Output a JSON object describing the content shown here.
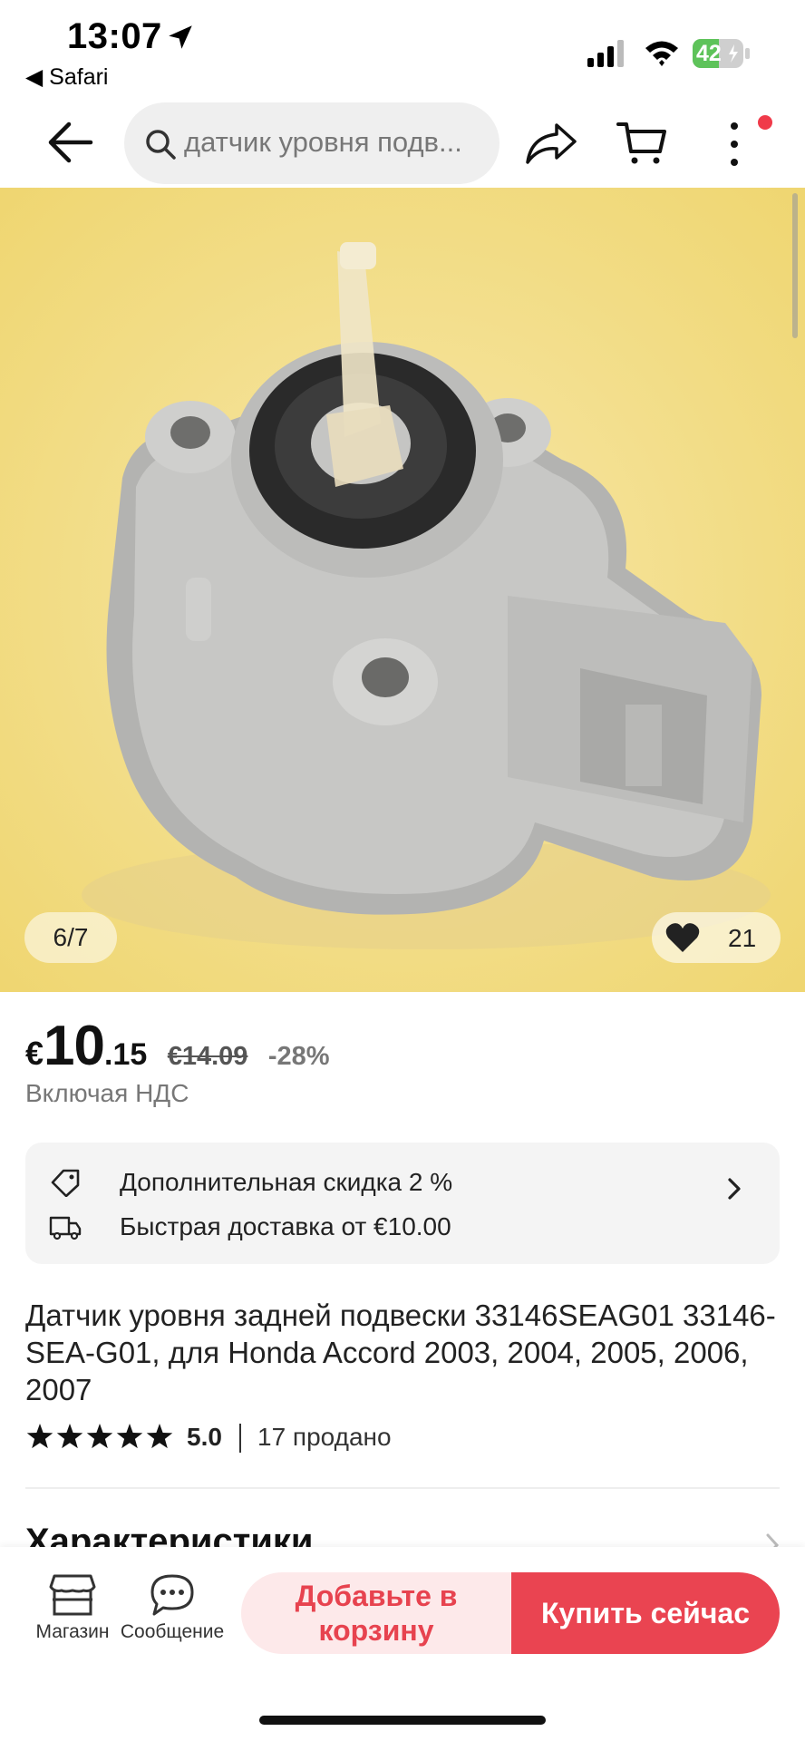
{
  "status_bar": {
    "time": "13:07",
    "back_app": "◀ Safari",
    "battery": "42"
  },
  "search": {
    "placeholder": "датчик уровня подв..."
  },
  "gallery": {
    "counter": "6/7",
    "likes": "21"
  },
  "price": {
    "currency": "€",
    "integer": "10",
    "decimal": ".15",
    "old": "€14.09",
    "discount": "-28%",
    "vat_note": "Включая НДС"
  },
  "promos": [
    {
      "icon": "tag-icon",
      "text": "Дополнительная скидка 2 %"
    },
    {
      "icon": "delivery-truck-icon",
      "text": "Быстрая доставка от €10.00"
    }
  ],
  "product": {
    "title": "Датчик уровня задней подвески 33146SEAG01 33146-SEA-G01, для Honda Accord 2003, 2004, 2005, 2006, 2007",
    "rating": "5.0",
    "stars": 5,
    "sold": "17 продано"
  },
  "section": {
    "title": "Характеристики"
  },
  "bottom_bar": {
    "store_label": "Магазин",
    "message_label": "Сообщение",
    "add_to_cart": "Добавьте в корзину",
    "buy_now": "Купить сейчас"
  },
  "colors": {
    "accent": "#ea4451",
    "accent_light": "#fde9ea",
    "notification": "#f03a4a"
  }
}
